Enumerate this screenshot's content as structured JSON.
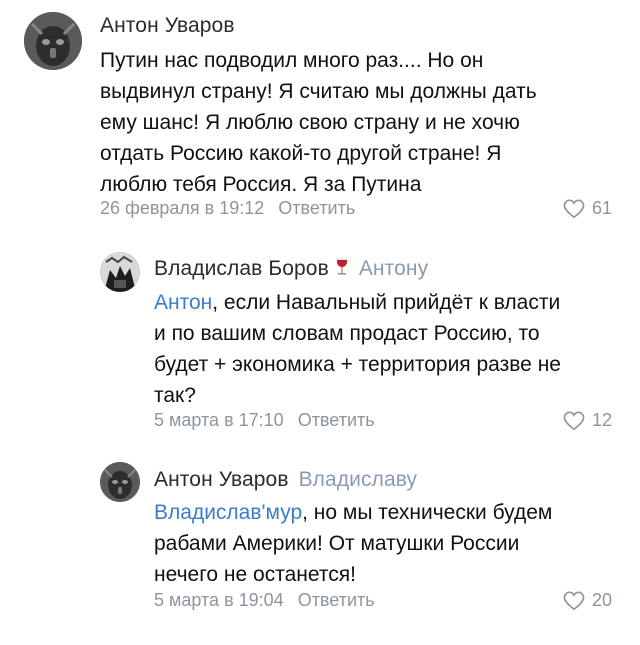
{
  "comments": [
    {
      "author": "Антон Уваров",
      "reply_to": "",
      "text_lines": [
        "Путин нас подводил много раз.... Но он",
        "выдвинул страну! Я считаю мы должны дать",
        "ему шанс! Я люблю свою страну и не хочю",
        "отдать Россию какой-то другой стране! Я",
        "люблю тебя Россия. Я за Путина"
      ],
      "date": "26 февраля в 19:12",
      "reply_label": "Ответить",
      "likes": "61"
    },
    {
      "author": "Владислав Боров",
      "author_emoji": "wine-glass-icon",
      "reply_to": "Антону",
      "mention": "Антон",
      "text_first_rest": ", если Навальный прийдёт к власти",
      "text_lines": [
        "и по вашим словам продаст Россию, то",
        "будет + экономика + территория разве не",
        "так?"
      ],
      "date": "5 марта в 17:10",
      "reply_label": "Ответить",
      "likes": "12"
    },
    {
      "author": "Антон Уваров",
      "reply_to": "Владиславу",
      "mention": "Владислав'мур",
      "text_first_rest": ", но мы технически будем",
      "text_lines": [
        "рабами Америки! От матушки России",
        "нечего не останется!"
      ],
      "date": "5 марта в 19:04",
      "reply_label": "Ответить",
      "likes": "20"
    }
  ],
  "colors": {
    "link": "#3d7cc9",
    "muted": "#8c959f",
    "reply_to": "#8a9bb0"
  }
}
